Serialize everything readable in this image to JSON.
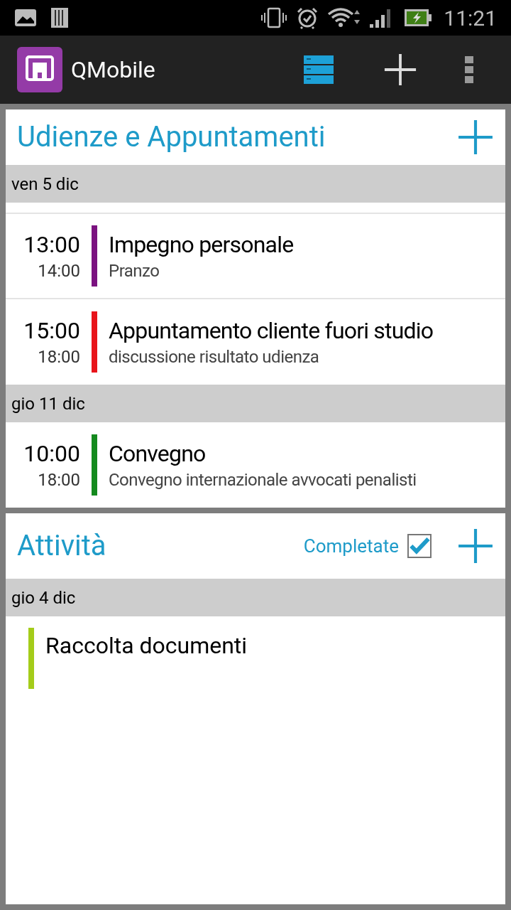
{
  "status_bar": {
    "time": "11:21"
  },
  "app_bar": {
    "title": "QMobile"
  },
  "appointments": {
    "title": "Udienze e Appuntamenti",
    "groups": [
      {
        "date": "ven 5 dic",
        "events": [
          {
            "start": "13:00",
            "end": "14:00",
            "title": "Impegno personale",
            "subtitle": "Pranzo",
            "color": "#7b1280"
          },
          {
            "start": "15:00",
            "end": "18:00",
            "title": "Appuntamento cliente fuori studio",
            "subtitle": "discussione risultato udienza",
            "color": "#e8141b"
          }
        ]
      },
      {
        "date": "gio 11 dic",
        "events": [
          {
            "start": "10:00",
            "end": "18:00",
            "title": "Convegno",
            "subtitle": "Convegno internazionale avvocati penalisti",
            "color": "#148a1e"
          }
        ]
      }
    ]
  },
  "tasks": {
    "title": "Attività",
    "completed_filter": {
      "label": "Completate",
      "checked": true
    },
    "groups": [
      {
        "date": "gio 4 dic",
        "tasks": [
          {
            "title": "Raccolta documenti",
            "color": "#a4cc1a"
          }
        ]
      }
    ]
  }
}
